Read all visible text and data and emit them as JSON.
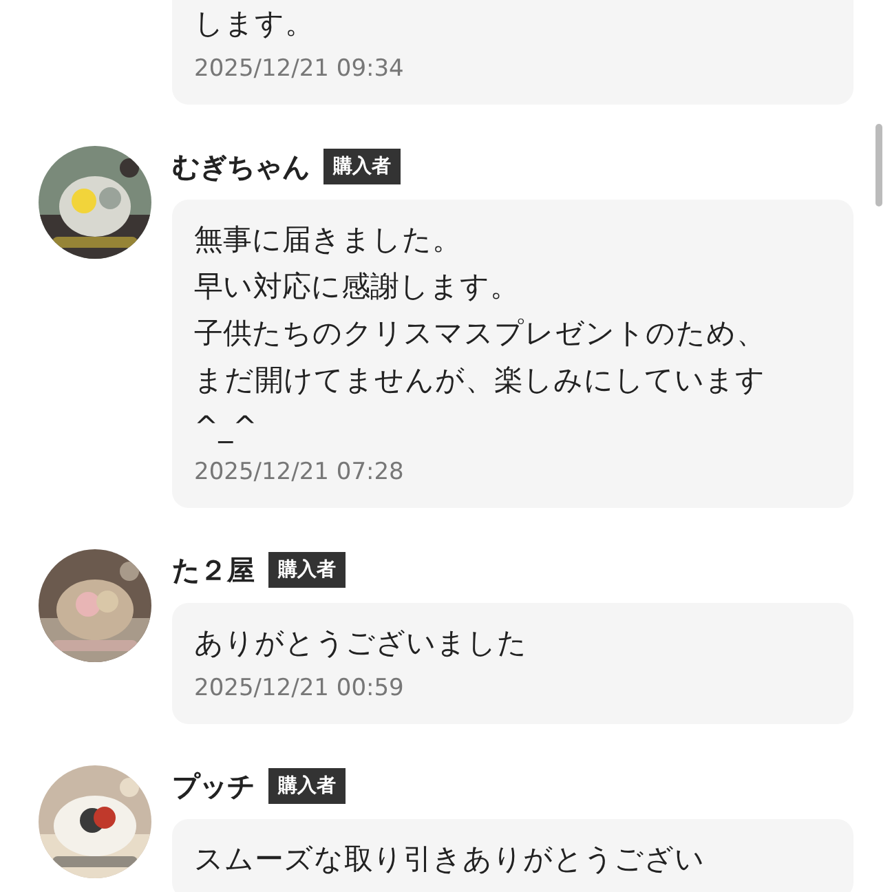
{
  "comments": [
    {
      "lines": [
        "します。"
      ],
      "time": "2025/12/21 09:34"
    },
    {
      "user": "むぎちゃん",
      "badge": "購入者",
      "lines": [
        "無事に届きました。",
        "早い対応に感謝します。",
        "子供たちのクリスマスプレゼントのため、",
        "まだ開けてませんが、楽しみにしています",
        "^_^"
      ],
      "time": "2025/12/21 07:28"
    },
    {
      "user": "た２屋",
      "badge": "購入者",
      "lines": [
        "ありがとうございました"
      ],
      "time": "2025/12/21 00:59"
    },
    {
      "user": "プッチ",
      "badge": "購入者",
      "lines": [
        "スムーズな取り引きありがとうござい"
      ]
    }
  ]
}
